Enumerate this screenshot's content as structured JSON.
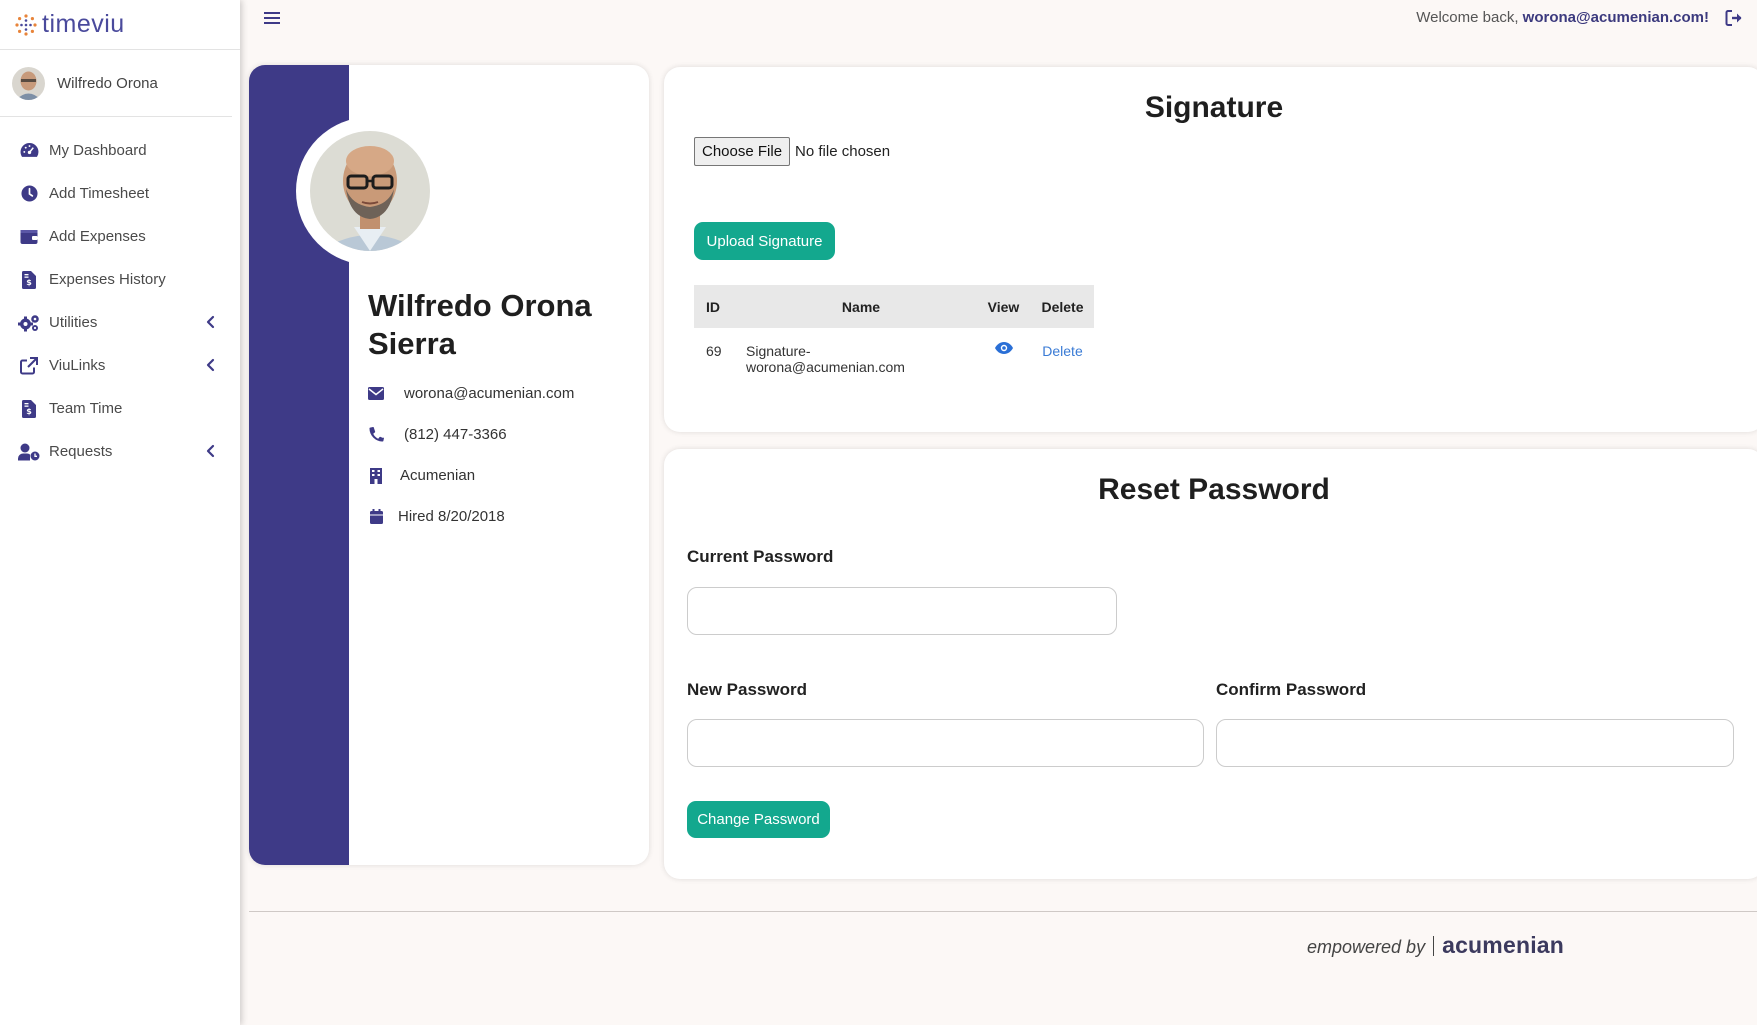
{
  "app": {
    "brand": "timeviu",
    "accent_color": "#3e3a87",
    "button_color": "#13a88e"
  },
  "sidebar": {
    "user_name": "Wilfredo Orona",
    "items": [
      {
        "label": "My Dashboard",
        "icon": "dashboard-icon"
      },
      {
        "label": "Add Timesheet",
        "icon": "clock-icon"
      },
      {
        "label": "Add Expenses",
        "icon": "wallet-icon"
      },
      {
        "label": "Expenses History",
        "icon": "invoice-icon"
      },
      {
        "label": "Utilities",
        "icon": "gears-icon",
        "has_submenu": true
      },
      {
        "label": "ViuLinks",
        "icon": "external-link-icon",
        "has_submenu": true
      },
      {
        "label": "Team Time",
        "icon": "invoice-icon"
      },
      {
        "label": "Requests",
        "icon": "user-clock-icon",
        "has_submenu": true
      }
    ]
  },
  "topbar": {
    "welcome_prefix": "Welcome back,",
    "welcome_user": "worona@acumenian.com!"
  },
  "profile": {
    "name": "Wilfredo Orona Sierra",
    "email": "worona@acumenian.com",
    "phone": "(812) 447-3366",
    "company": "Acumenian",
    "hired": "Hired 8/20/2018"
  },
  "signature": {
    "title": "Signature",
    "choose_file_label": "Choose File",
    "file_status": "No file chosen",
    "upload_button": "Upload Signature",
    "table": {
      "headers": [
        "ID",
        "Name",
        "View",
        "Delete"
      ],
      "rows": [
        {
          "id": "69",
          "name_line1": "Signature-",
          "name_line2": "worona@acumenian.com",
          "view_icon": "eye-icon",
          "delete_label": "Delete"
        }
      ]
    }
  },
  "reset_password": {
    "title": "Reset Password",
    "current_label": "Current Password",
    "current_value": "",
    "new_label": "New Password",
    "new_value": "",
    "confirm_label": "Confirm Password",
    "confirm_value": "",
    "submit_button": "Change Password"
  },
  "footer": {
    "empowered_by": "empowered by",
    "brand": "acumenian"
  }
}
